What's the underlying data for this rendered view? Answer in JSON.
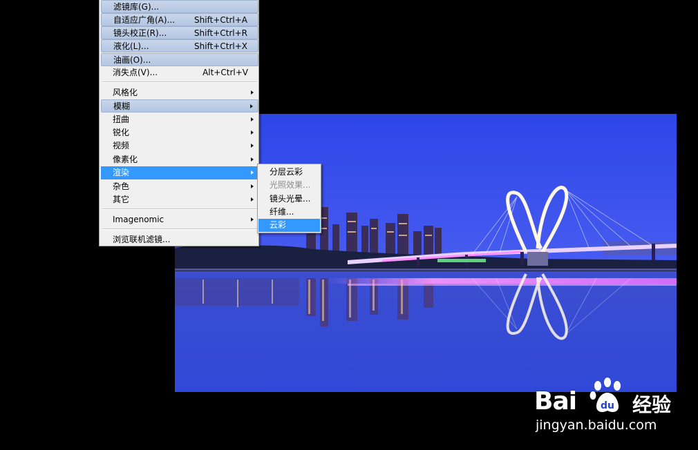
{
  "filter_menu": {
    "items": [
      {
        "label": "滤镜库(G)...",
        "shortcut": ""
      },
      {
        "label": "自适应广角(A)...",
        "shortcut": "Shift+Ctrl+A"
      },
      {
        "label": "镜头校正(R)...",
        "shortcut": "Shift+Ctrl+R"
      },
      {
        "label": "液化(L)...",
        "shortcut": "Shift+Ctrl+X"
      },
      {
        "label": "油画(O)...",
        "shortcut": ""
      },
      {
        "label": "消失点(V)...",
        "shortcut": "Alt+Ctrl+V"
      },
      {
        "label": "风格化"
      },
      {
        "label": "模糊"
      },
      {
        "label": "扭曲"
      },
      {
        "label": "锐化"
      },
      {
        "label": "视频"
      },
      {
        "label": "像素化"
      },
      {
        "label": "渲染"
      },
      {
        "label": "杂色"
      },
      {
        "label": "其它"
      },
      {
        "label": "Imagenomic"
      },
      {
        "label": "浏览联机滤镜..."
      }
    ]
  },
  "render_submenu": {
    "items": [
      {
        "label": "分层云彩"
      },
      {
        "label": "光照效果..."
      },
      {
        "label": "镜头光晕..."
      },
      {
        "label": "纤维..."
      },
      {
        "label": "云彩"
      }
    ]
  },
  "watermark": {
    "logo_left": "Bai",
    "logo_right": "经验",
    "url": "jingyan.baidu.com"
  },
  "colors": {
    "menu_bg": "#f0f0f0",
    "selected": "#3399ff",
    "highlight": "#b3c6e2",
    "sky": "#3a55e6"
  }
}
